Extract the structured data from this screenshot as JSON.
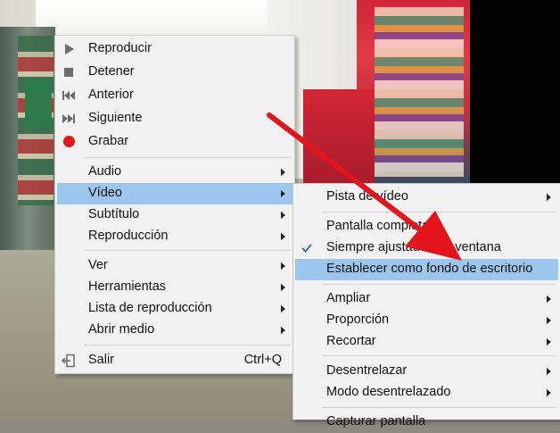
{
  "main_menu": {
    "items": [
      {
        "label": "Reproducir",
        "icon": "play-icon"
      },
      {
        "label": "Detener",
        "icon": "stop-icon"
      },
      {
        "label": "Anterior",
        "icon": "previous-icon"
      },
      {
        "label": "Siguiente",
        "icon": "next-icon"
      },
      {
        "label": "Grabar",
        "icon": "record-icon"
      },
      {
        "label": "Audio"
      },
      {
        "label": "Vídeo"
      },
      {
        "label": "Subtítulo"
      },
      {
        "label": "Reproducción"
      },
      {
        "label": "Ver"
      },
      {
        "label": "Herramientas"
      },
      {
        "label": "Lista de reproducción"
      },
      {
        "label": "Abrir medio"
      },
      {
        "label": "Salir",
        "shortcut": "Ctrl+Q",
        "icon": "exit-icon"
      }
    ]
  },
  "sub_menu": {
    "items": [
      {
        "label": "Pista de vídeo"
      },
      {
        "label": "Pantalla completa"
      },
      {
        "label": "Siempre ajustado a la ventana",
        "checked": true
      },
      {
        "label": "Establecer como fondo de escritorio"
      },
      {
        "label": "Ampliar"
      },
      {
        "label": "Proporción"
      },
      {
        "label": "Recortar"
      },
      {
        "label": "Desentrelazar"
      },
      {
        "label": "Modo desentrelazado"
      },
      {
        "label": "Capturar pantalla"
      }
    ]
  },
  "colors": {
    "highlight": "#9dc6ee",
    "menu_bg": "#f2f2f2",
    "record": "#e01818",
    "annotation_arrow": "#e3141b"
  }
}
